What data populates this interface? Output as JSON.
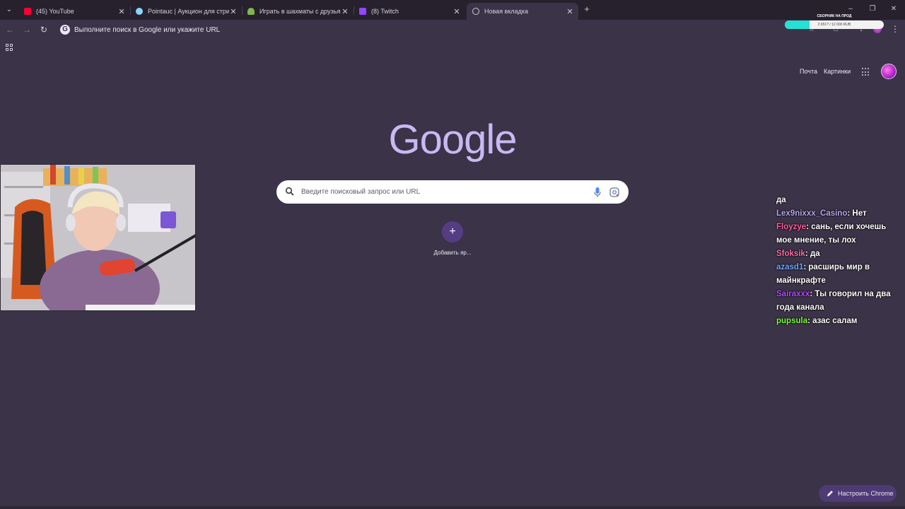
{
  "tabs": [
    {
      "title": "(45) YouTube",
      "favicon": "youtube-icon",
      "color": "#ff0033"
    },
    {
      "title": "Pointauc | Аукцион для стриме",
      "favicon": "pointauc-icon",
      "color": "#8ad5ff"
    },
    {
      "title": "Играть в шахматы с друзьями",
      "favicon": "chess-pawn-icon",
      "color": "#81b64c"
    },
    {
      "title": "(8) Twitch",
      "favicon": "twitch-icon",
      "color": "#9146ff"
    },
    {
      "title": "Новая вкладка",
      "favicon": "chrome-newtab-icon",
      "color": "#cfc7da",
      "active": true
    }
  ],
  "toolbar": {
    "omnibox_text": "Выполните поиск в Google или укажите URL"
  },
  "donation_goal": {
    "title": "СБОРНИК НА ПРОД",
    "amount": "2 651? / 12 000 RUB",
    "progress": 0.25,
    "fill_color": "#24e1d6"
  },
  "ntp": {
    "mail_link": "Почта",
    "images_link": "Картинки",
    "logo": "Google",
    "logo_color": "#c9b8f3",
    "search_placeholder": "Введите поисковый запрос или URL",
    "add_shortcut_label": "Добавить яр...",
    "customize_label": "Настроить Chrome"
  },
  "chat": [
    {
      "user": "",
      "color": "",
      "message": "да"
    },
    {
      "user": "Lex9nixxx_Casino",
      "color": "#b8a7f0",
      "message": "Нет"
    },
    {
      "user": "Floyzye",
      "color": "#ff5e9c",
      "message": "сань, если хочешь мое мнение, ты лох"
    },
    {
      "user": "Sfoksik",
      "color": "#ff6fa8",
      "message": "да"
    },
    {
      "user": "azasd1",
      "color": "#6fa8ff",
      "message": "расширь мир в майнкрафте"
    },
    {
      "user": "Sairaxxx",
      "color": "#b44cff",
      "message": "Ты говорил на два года канала"
    },
    {
      "user": "pupsula",
      "color": "#7cff3a",
      "message": "азас салам"
    }
  ]
}
